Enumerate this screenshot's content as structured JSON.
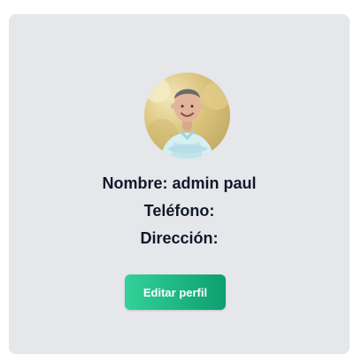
{
  "profile": {
    "avatar_alt": "profile-photo",
    "name_line": "Nombre: admin paul",
    "phone_line": "Teléfono:",
    "address_line": "Dirección:"
  },
  "actions": {
    "edit_label": "Editar perfil"
  }
}
